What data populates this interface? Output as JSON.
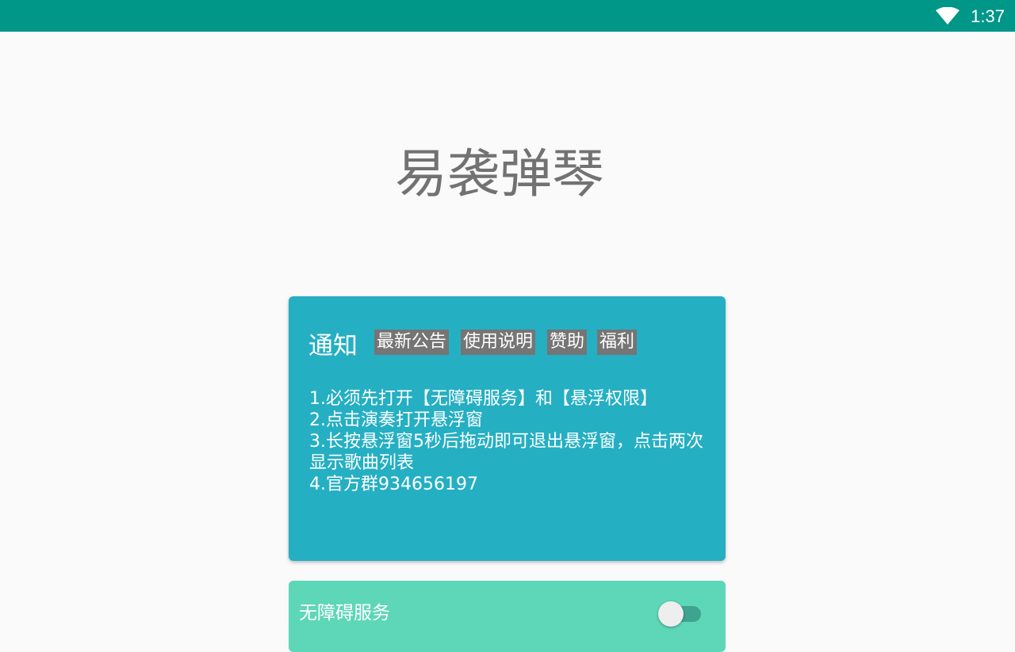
{
  "status_bar": {
    "time": "1:37",
    "wifi_icon": "wifi-icon",
    "background": "#009688"
  },
  "app": {
    "title": "易袭弹琴"
  },
  "notice": {
    "heading": "通知",
    "tabs": [
      {
        "label": "最新公告"
      },
      {
        "label": "使用说明"
      },
      {
        "label": "赞助"
      },
      {
        "label": "福利"
      }
    ],
    "lines": [
      "1.必须先打开【无障碍服务】和【悬浮权限】",
      "2.点击演奏打开悬浮窗",
      "3.长按悬浮窗5秒后拖动即可退出悬浮窗，点击两次",
      "显示歌曲列表",
      "4.官方群934656197"
    ],
    "background": "#25afc3",
    "tab_background": "#757575"
  },
  "accessibility_service": {
    "label": "无障碍服务",
    "enabled": false,
    "background": "#5ed6b8"
  }
}
